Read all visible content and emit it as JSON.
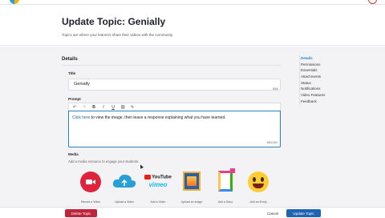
{
  "header": {
    "title": "Update Topic: Genially",
    "subtitle": "Topics are where your learners share their videos with the community."
  },
  "details": {
    "section_title": "Details",
    "title_label": "Title",
    "title_value": "Genially",
    "title_count": "8/80",
    "prompt_label": "Prompt",
    "prompt_link": "Click here",
    "prompt_rest": " to view the image, then leave a response explaining what you have learned.",
    "prompt_count": "85/1000"
  },
  "toolbar": {
    "undo_icon": "undo-icon",
    "redo_icon": "redo-icon",
    "bold": "B",
    "italic": "I",
    "underline": "U",
    "link_icon": "link-icon",
    "clear_icon": "clear-format-icon"
  },
  "media": {
    "label": "Media",
    "subtitle": "Add a media resource to engage your students.",
    "items": [
      {
        "label": "Record a Video",
        "icon": "record-video-icon"
      },
      {
        "label": "Upload a Video",
        "icon": "upload-cloud-icon"
      },
      {
        "label": "Add a Video",
        "icon": "youtube-vimeo-icon",
        "brand1": "YouTube",
        "brand2": "vimeo"
      },
      {
        "label": "Upload an Image",
        "icon": "image-icon"
      },
      {
        "label": "Add a Story",
        "icon": "story-icon"
      },
      {
        "label": "Add an Emoji",
        "icon": "emoji-icon"
      }
    ]
  },
  "sidenav": {
    "items": [
      "Details",
      "Permissions",
      "Essentials",
      "Attachments",
      "Status",
      "Notifications",
      "Video Features",
      "Feedback"
    ]
  },
  "footer": {
    "delete_label": "Delete Topic",
    "cancel_label": "Cancel",
    "update_label": "Update Topic"
  },
  "colors": {
    "primary": "#1f63b5",
    "danger": "#c0243a",
    "accent": "#2a80c8"
  }
}
